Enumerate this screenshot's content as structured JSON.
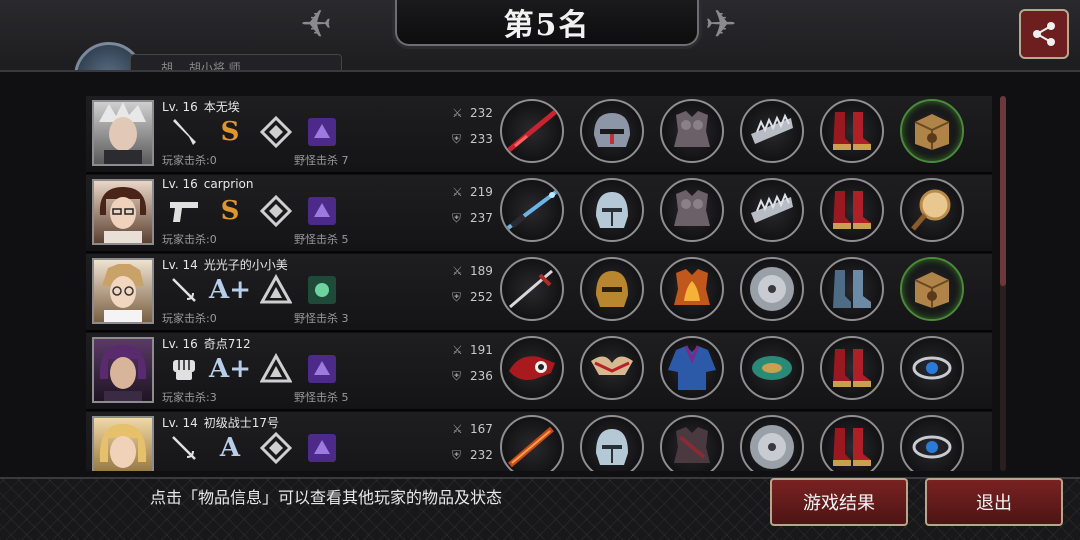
{
  "header": {
    "title": "第5名",
    "hidden_tab_text": "胡… 胡小将 师"
  },
  "players": [
    {
      "level": "Lv. 16",
      "name": "本无埃",
      "rank": "S",
      "player_kills_label": "玩家击杀:0",
      "monster_kills_label": "野怪击杀 7",
      "attack": "232",
      "defense": "233",
      "weapon_icon": "knife-icon",
      "skill_icon": "purple-skill-icon",
      "equipment": [
        "red-lance-icon",
        "steel-helmet-icon",
        "plate-armor-icon",
        "spiked-bracer-icon",
        "red-boots-icon",
        "treasure-box-icon"
      ]
    },
    {
      "level": "Lv. 16",
      "name": "carprion",
      "rank": "S",
      "player_kills_label": "玩家击杀:0",
      "monster_kills_label": "野怪击杀 5",
      "attack": "219",
      "defense": "237",
      "weapon_icon": "pistol-icon",
      "skill_icon": "purple-skill-icon",
      "equipment": [
        "blue-rifle-icon",
        "silver-helmet-icon",
        "plate-armor-icon",
        "spiked-bracer-icon",
        "red-boots-icon",
        "magnifier-icon"
      ]
    },
    {
      "level": "Lv. 14",
      "name": "光光子的小小美",
      "rank": "A+",
      "player_kills_label": "玩家击杀:0",
      "monster_kills_label": "野怪击杀 3",
      "attack": "189",
      "defense": "252",
      "weapon_icon": "rapier-icon",
      "skill_icon": "green-skill-icon",
      "equipment": [
        "long-sword-icon",
        "gold-helmet-icon",
        "flame-armor-icon",
        "disc-icon",
        "steel-boots-icon",
        "treasure-box-icon"
      ]
    },
    {
      "level": "Lv. 16",
      "name": "奇点712",
      "rank": "A+",
      "player_kills_label": "玩家击杀:3",
      "monster_kills_label": "野怪击杀 5",
      "attack": "191",
      "defense": "236",
      "weapon_icon": "fist-icon",
      "skill_icon": "purple-skill-icon",
      "equipment": [
        "red-gauntlet-icon",
        "horned-mask-icon",
        "blue-robe-icon",
        "jade-bracelet-icon",
        "red-boots-icon",
        "sapphire-ring-icon"
      ]
    },
    {
      "level": "Lv. 14",
      "name": "初级战士17号",
      "rank": "A",
      "player_kills_label": "",
      "monster_kills_label": "",
      "attack": "167",
      "defense": "232",
      "weapon_icon": "rapier-icon",
      "skill_icon": "purple-skill-icon",
      "equipment": [
        "flame-sword-icon",
        "silver-helmet-icon",
        "dark-armor-icon",
        "disc-icon",
        "red-boots-icon",
        "sapphire-ring-icon"
      ]
    }
  ],
  "footer": {
    "hint": "点击「物品信息」可以查看其他玩家的物品及状态",
    "result_button": "游戏结果",
    "exit_button": "退出"
  },
  "colors": {
    "button_red": "#7a2222",
    "rank_s": "#e0962f",
    "rank_a": "#b7cde8"
  }
}
